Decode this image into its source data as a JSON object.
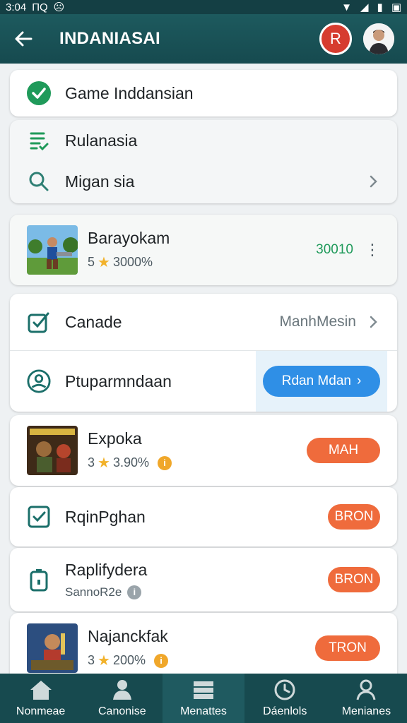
{
  "status_bar": {
    "time": "3:04",
    "left_extra": "ПQ"
  },
  "app_bar": {
    "title": "INDANIASAI",
    "avatar_letter": "R"
  },
  "card_game": {
    "label": "Game Inddansian",
    "icon": "check-circle-icon"
  },
  "menu_card": {
    "items": [
      {
        "label": "Rulanasia",
        "icon": "list-check-icon"
      },
      {
        "label": "Migan sia",
        "icon": "search-icon"
      }
    ]
  },
  "featured_game": {
    "name": "Barayokam",
    "rating_num": "5",
    "rating_pct": "3000%",
    "score": "30010"
  },
  "settings_card": {
    "row1": {
      "label": "Canade",
      "value": "ManhMesin"
    },
    "row2": {
      "label": "Ptuparmndaan",
      "button": "Rdan Mdan"
    }
  },
  "game_list": [
    {
      "name": "Expoka",
      "rating_num": "3",
      "rating_pct": "3.90%",
      "action": "MAH"
    },
    {
      "name": "RqinPghan",
      "action": "BRON"
    },
    {
      "name": "Raplifydera",
      "sub": "SannoR2e",
      "action": "BRON"
    },
    {
      "name": "Najanckfak",
      "rating_num": "3",
      "rating_pct": "200%",
      "action": "TRON"
    }
  ],
  "bottom_nav": [
    {
      "label": "Nonmeae",
      "icon": "home-icon"
    },
    {
      "label": "Canonise",
      "icon": "person-icon"
    },
    {
      "label": "Menattes",
      "icon": "layers-icon"
    },
    {
      "label": "Dáenlols",
      "icon": "clock-icon"
    },
    {
      "label": "Menianes",
      "icon": "profile-icon"
    }
  ],
  "colors": {
    "app_bar": "#164a4f",
    "accent_green": "#1f9a5a",
    "action_orange": "#ef6b3c",
    "button_blue": "#2f8fe6"
  }
}
